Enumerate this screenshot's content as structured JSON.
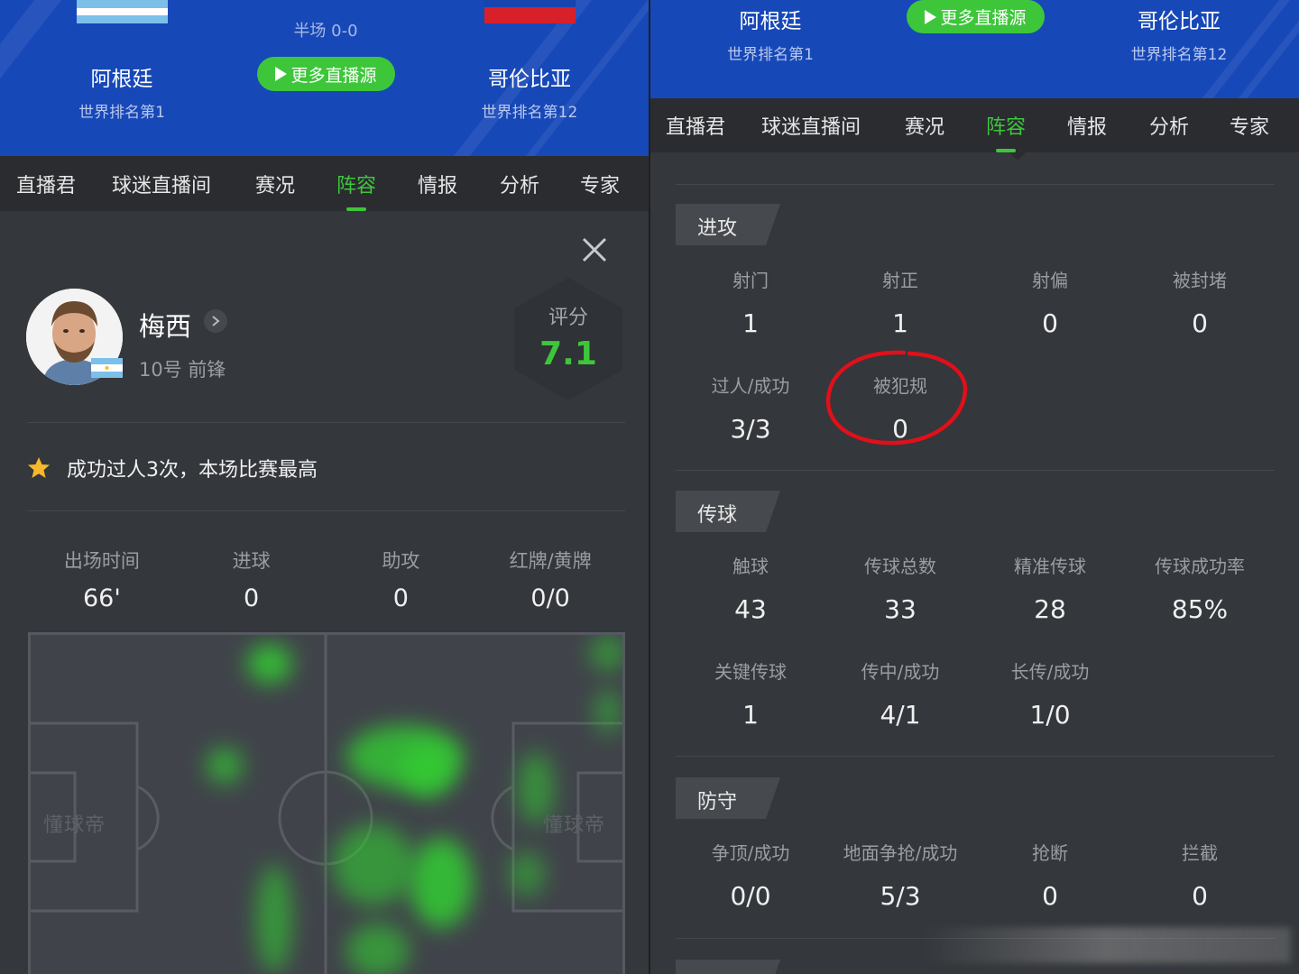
{
  "left": {
    "header": {
      "half_score": "半场 0-0",
      "home": {
        "name": "阿根廷",
        "rank": "世界排名第1"
      },
      "away": {
        "name": "哥伦比亚",
        "rank": "世界排名第12"
      },
      "live_button": "更多直播源"
    },
    "tabs": [
      "直播君",
      "球迷直播间",
      "赛况",
      "阵容",
      "情报",
      "分析",
      "专家"
    ],
    "active_tab": "阵容",
    "player": {
      "name": "梅西",
      "info": "10号 前锋",
      "rating_label": "评分",
      "rating_value": "7.1",
      "highlight": "成功过人3次，本场比赛最高"
    },
    "summary_stats": [
      {
        "label": "出场时间",
        "value": "66'"
      },
      {
        "label": "进球",
        "value": "0"
      },
      {
        "label": "助攻",
        "value": "0"
      },
      {
        "label": "红牌/黄牌",
        "value": "0/0"
      }
    ],
    "pitch_watermark": "懂球帝"
  },
  "right": {
    "header": {
      "home": {
        "name": "阿根廷",
        "rank": "世界排名第1"
      },
      "away": {
        "name": "哥伦比亚",
        "rank": "世界排名第12"
      },
      "live_button": "更多直播源"
    },
    "tabs": [
      "直播君",
      "球迷直播间",
      "赛况",
      "阵容",
      "情报",
      "分析",
      "专家"
    ],
    "active_tab": "阵容",
    "sections": {
      "attack": {
        "title": "进攻",
        "row1": [
          {
            "label": "射门",
            "value": "1"
          },
          {
            "label": "射正",
            "value": "1"
          },
          {
            "label": "射偏",
            "value": "0"
          },
          {
            "label": "被封堵",
            "value": "0"
          }
        ],
        "row2": [
          {
            "label": "过人/成功",
            "value": "3/3"
          },
          {
            "label": "被犯规",
            "value": "0"
          }
        ]
      },
      "passing": {
        "title": "传球",
        "row1": [
          {
            "label": "触球",
            "value": "43"
          },
          {
            "label": "传球总数",
            "value": "33"
          },
          {
            "label": "精准传球",
            "value": "28"
          },
          {
            "label": "传球成功率",
            "value": "85%"
          }
        ],
        "row2": [
          {
            "label": "关键传球",
            "value": "1"
          },
          {
            "label": "传中/成功",
            "value": "4/1"
          },
          {
            "label": "长传/成功",
            "value": "1/0"
          }
        ]
      },
      "defense": {
        "title": "防守",
        "row1": [
          {
            "label": "争顶/成功",
            "value": "0/0"
          },
          {
            "label": "地面争抢/成功",
            "value": "5/3"
          },
          {
            "label": "抢断",
            "value": "0"
          },
          {
            "label": "拦截",
            "value": "0"
          }
        ]
      }
    }
  },
  "colors": {
    "accent_green": "#3ec63b",
    "header_blue": "#1748b8",
    "annotation_red": "#e0101a"
  }
}
